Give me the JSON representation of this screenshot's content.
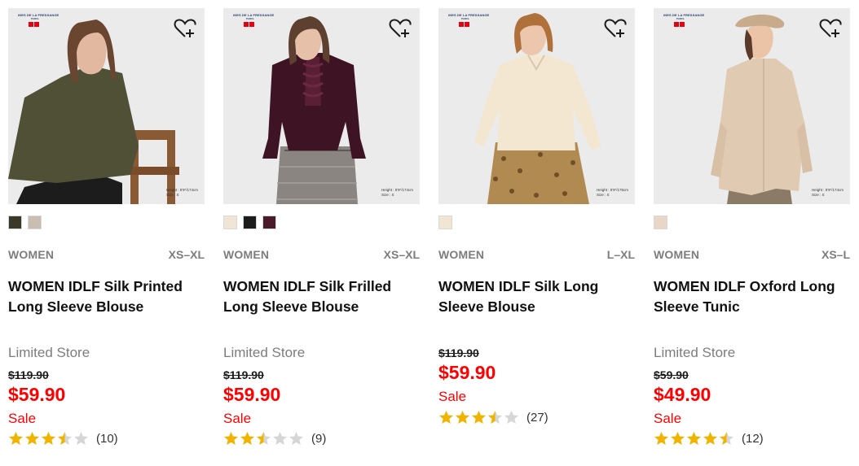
{
  "products": [
    {
      "brand_logo": "INES DE LA FRESSANGE",
      "brand_sub": "PARIS",
      "height_note": [
        "Height : 5'9\"/174cm",
        "Size : S"
      ],
      "swatches": [
        "#3a3826",
        "#c8bfb2"
      ],
      "gender": "WOMEN",
      "sizes": "XS–XL",
      "name": "WOMEN IDLF Silk Printed Long Sleeve Blouse",
      "flag": "Limited Store",
      "original_price": "$119.90",
      "price": "$59.90",
      "sale": "Sale",
      "rating": 3.5,
      "review_count": "(10)"
    },
    {
      "brand_logo": "INES DE LA FRESSANGE",
      "brand_sub": "PARIS",
      "height_note": [
        "Height : 5'9\"/174cm",
        "Size : S"
      ],
      "swatches": [
        "#efe6d8",
        "#1c1c1c",
        "#4a1c2a"
      ],
      "gender": "WOMEN",
      "sizes": "XS–XL",
      "name": "WOMEN IDLF Silk Frilled Long Sleeve Blouse",
      "flag": "Limited Store",
      "original_price": "$119.90",
      "price": "$59.90",
      "sale": "Sale",
      "rating": 2.5,
      "review_count": "(9)"
    },
    {
      "brand_logo": "INES DE LA FRESSANGE",
      "brand_sub": "PARIS",
      "height_note": [
        "Height : 5'9\"/175cm",
        "Size : S"
      ],
      "swatches": [
        "#f1e6d4"
      ],
      "gender": "WOMEN",
      "sizes": "L–XL",
      "name": "WOMEN IDLF Silk Long Sleeve Blouse",
      "flag": "",
      "original_price": "$119.90",
      "price": "$59.90",
      "sale": "Sale",
      "rating": 3.5,
      "review_count": "(27)"
    },
    {
      "brand_logo": "INES DE LA FRESSANGE",
      "brand_sub": "PARIS",
      "height_note": [
        "Height : 5'9\"/174cm",
        "Size : S"
      ],
      "swatches": [
        "#e9d6c7"
      ],
      "gender": "WOMEN",
      "sizes": "XS–L",
      "name": "WOMEN IDLF Oxford Long Sleeve Tunic",
      "flag": "Limited Store",
      "original_price": "$59.90",
      "price": "$49.90",
      "sale": "Sale",
      "rating": 4.5,
      "review_count": "(12)"
    }
  ],
  "colors": {
    "price_red": "#ff0000",
    "star_gold": "#f0b400",
    "star_empty": "#d6d6d6",
    "muted_text": "#7d7d7d"
  },
  "icons": {
    "wishlist": "heart-plus-icon",
    "star": "star-icon"
  }
}
